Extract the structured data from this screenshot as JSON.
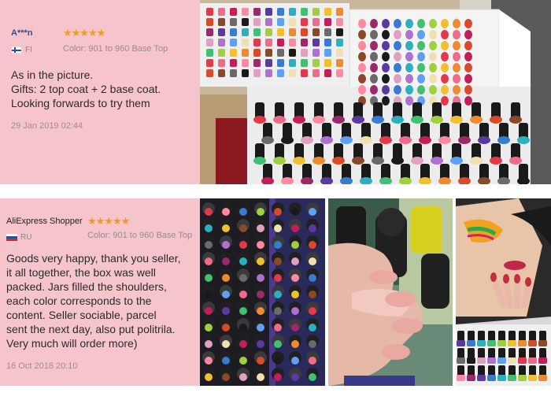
{
  "reviews": [
    {
      "author": "A***n",
      "rating": 5,
      "stars": "★★★★★",
      "country": "FI",
      "color": "Color: 901 to 960 Base Top",
      "text": [
        "As in the picture.",
        "Gifts: 2 top coat + 2 base coat.",
        "Looking forwards to try them"
      ],
      "date": "29 Jan 2019 02:44",
      "photos": [
        "nail-polish-color-chart-photo"
      ]
    },
    {
      "author": "AliExpress Shopper",
      "rating": 5,
      "stars": "★★★★★",
      "country": "RU",
      "color": "Color: 901 to 960 Base Top",
      "text": [
        "Goods very happy, thank you seller,",
        "it all together, the box was well",
        "packed. Jars filled the shoulders,",
        "each color corresponds to the",
        "content. Seller sociable, parcel",
        "sent the next day, also put politrila.",
        "Very much will order more)"
      ],
      "date": "16 Oct 2018 20:10",
      "photos": [
        "nail-polish-bottles-photo",
        "painted-nails-photo",
        "model-display-photo"
      ]
    }
  ],
  "colors": {
    "panel_bg": "#f6c5cc",
    "author": "#3a4a8c",
    "stars": "#f29a1e",
    "meta": "#9a8a8c",
    "body_text": "#2a2a2a"
  }
}
